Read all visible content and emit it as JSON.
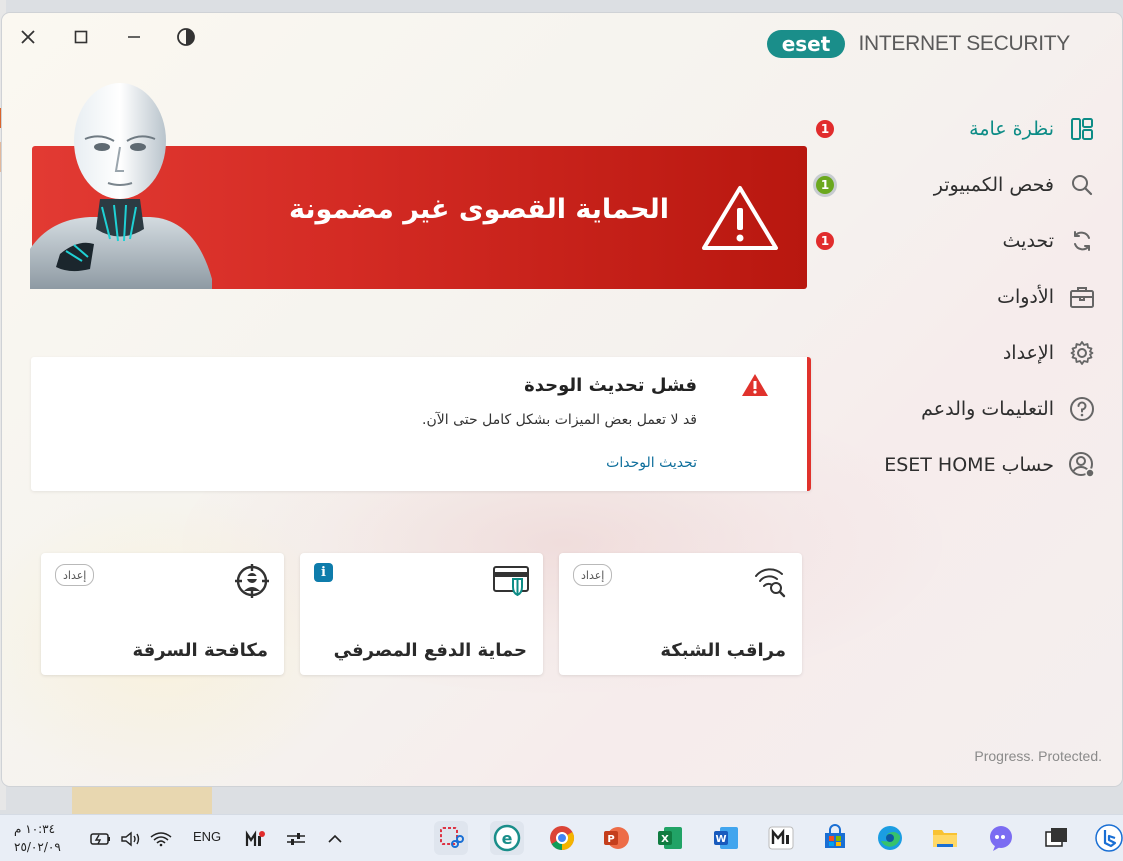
{
  "window": {
    "brand_logo_text": "eset",
    "product_name": "INTERNET SECURITY",
    "tagline": "Progress. Protected."
  },
  "nav": {
    "items": [
      {
        "label": "نظرة عامة",
        "icon": "overview-icon",
        "badge": "1",
        "badge_color": "#e12c2c",
        "active": true
      },
      {
        "label": "فحص الكمبيوتر",
        "icon": "search-icon",
        "badge": "1",
        "badge_color": "#6ba81e",
        "active": false
      },
      {
        "label": "تحديث",
        "icon": "refresh-icon",
        "badge": "1",
        "badge_color": "#e12c2c",
        "active": false
      },
      {
        "label": "الأدوات",
        "icon": "toolbox-icon",
        "badge": "",
        "active": false
      },
      {
        "label": "الإعداد",
        "icon": "gear-icon",
        "badge": "",
        "active": false
      },
      {
        "label": "التعليمات والدعم",
        "icon": "help-icon",
        "badge": "",
        "active": false
      },
      {
        "label": "حساب ESET HOME",
        "icon": "account-icon",
        "badge": "",
        "active": false
      }
    ]
  },
  "banner": {
    "title": "الحماية القصوى غير مضمونة",
    "color": "#d42b24"
  },
  "alert": {
    "title": "فشل تحديث الوحدة",
    "description": "قد لا تعمل بعض الميزات بشكل كامل حتى الآن.",
    "link": "تحديث الوحدات"
  },
  "tiles": [
    {
      "name": "مراقب الشبكة",
      "icon": "network-inspector-icon",
      "action": "إعداد"
    },
    {
      "name": "حماية الدفع المصرفي",
      "icon": "banking-protection-icon",
      "action": "i"
    },
    {
      "name": "مكافحة السرقة",
      "icon": "anti-theft-icon",
      "action": "إعداد"
    }
  ],
  "taskbar": {
    "time": "١٠:٣٤ م",
    "date": "٢٥/٠٢/٠٩",
    "language": "ENG"
  },
  "colors": {
    "accent": "#0d8c86",
    "danger": "#e0322c",
    "link": "#0f6f9c"
  }
}
